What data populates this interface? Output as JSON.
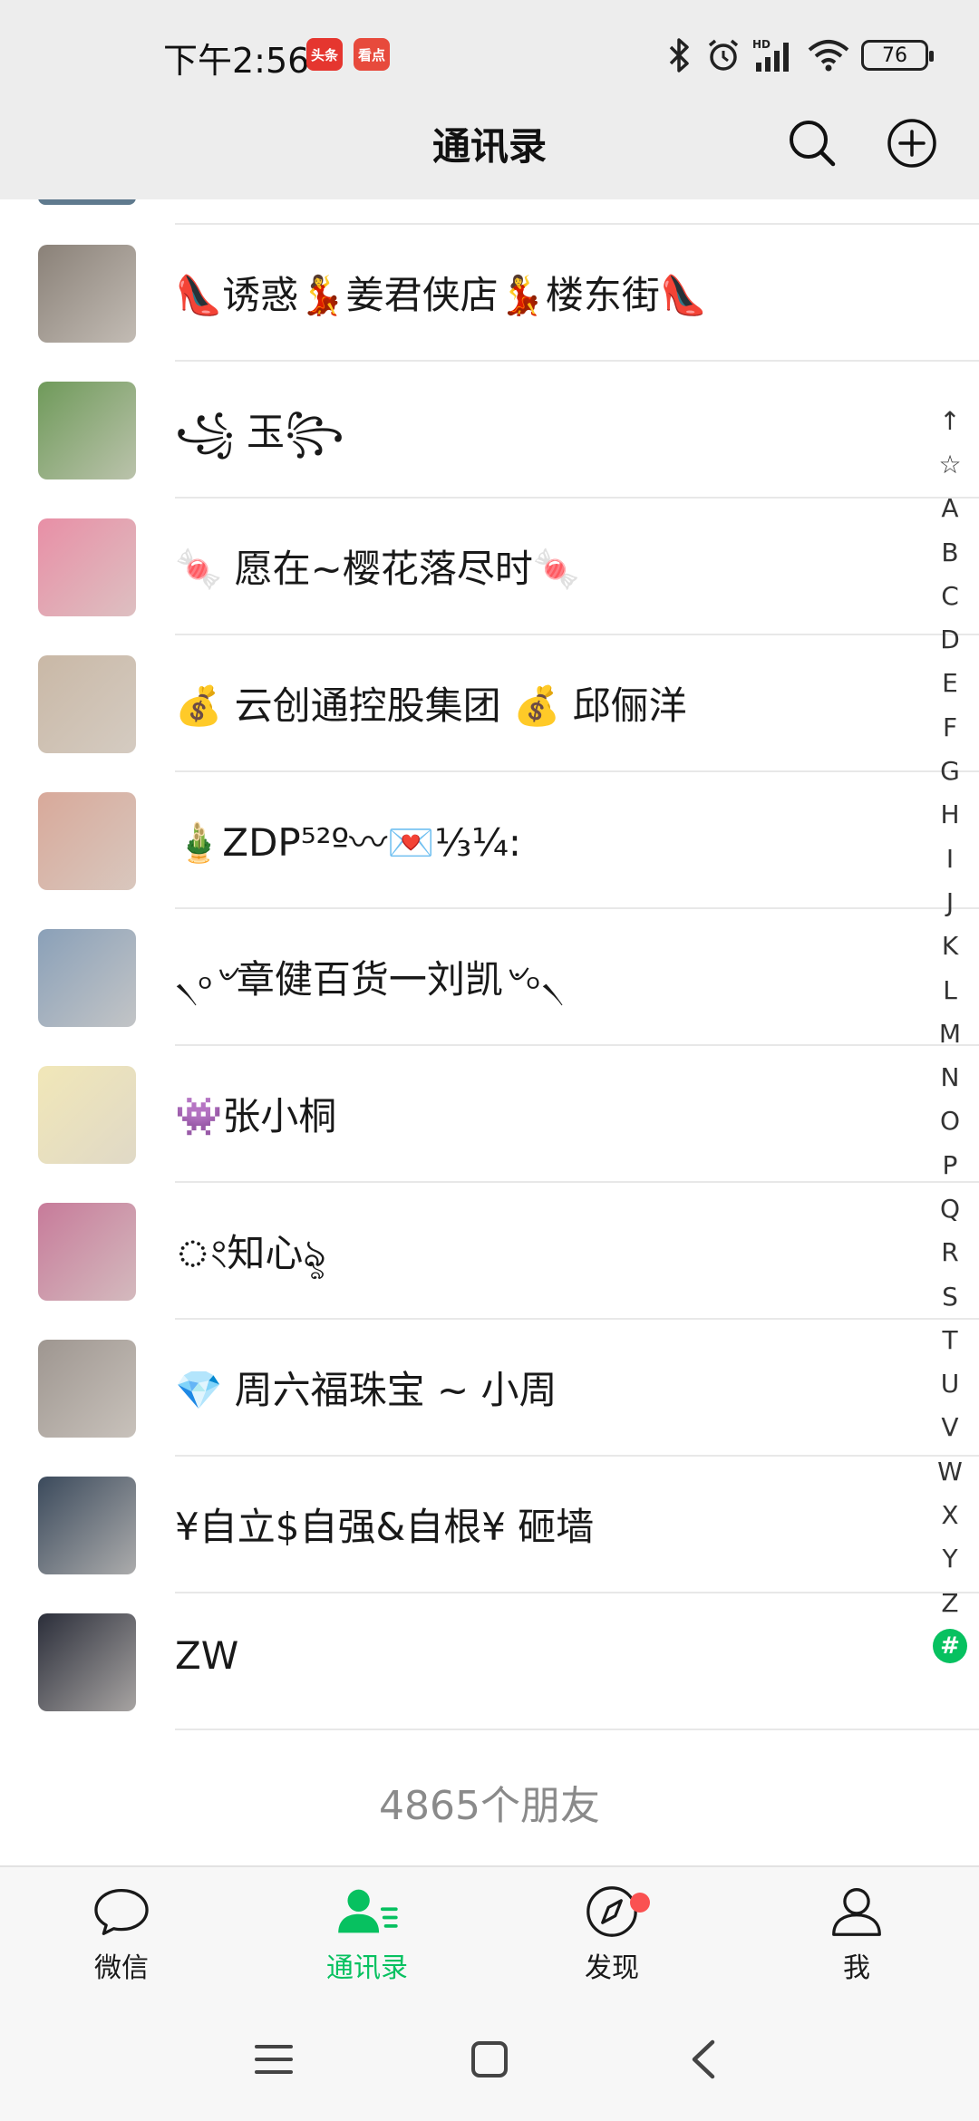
{
  "status_bar": {
    "time": "下午2:56",
    "app1": "头条",
    "app2": "看点",
    "battery": "76"
  },
  "header": {
    "title": "通讯录",
    "search_icon": "search-icon",
    "add_icon": "add-circle-icon"
  },
  "contacts": [
    {
      "name": "👠诱惑💃姜君侠店💃楼东街👠",
      "avatar_color": "#8a8178"
    },
    {
      "name": "꧁ 玉꧂",
      "avatar_color": "#6f9a5a"
    },
    {
      "name": "🍬 愿在~樱花落尽时🍬",
      "avatar_color": "#e88fa6"
    },
    {
      "name": "💰 云创通控股集团 💰 邱俪洋",
      "avatar_color": "#c9b8a6"
    },
    {
      "name": "🎍ZDP⁵²º〰💌⅓¼:",
      "avatar_color": "#d8a99a"
    },
    {
      "name": "৲৹৺章健百货一刘凯৺৹৲",
      "avatar_color": "#8aa0b8"
    },
    {
      "name": "👾张小桐",
      "avatar_color": "#f1e7b8"
    },
    {
      "name": "ং知心ৡ",
      "avatar_color": "#c77b9a"
    },
    {
      "name": "💎 周六福珠宝 ~ 小周",
      "avatar_color": "#9e9690"
    },
    {
      "name": "¥自立$自强&自根¥ 砸墙",
      "avatar_color": "#3b4a5c"
    },
    {
      "name": "ZW",
      "avatar_color": "#2b2e3a"
    }
  ],
  "friend_count": "4865个朋友",
  "index": [
    "↑",
    "☆",
    "A",
    "B",
    "C",
    "D",
    "E",
    "F",
    "G",
    "H",
    "I",
    "J",
    "K",
    "L",
    "M",
    "N",
    "O",
    "P",
    "Q",
    "R",
    "S",
    "T",
    "U",
    "V",
    "W",
    "X",
    "Y",
    "Z",
    "#"
  ],
  "tabs": [
    {
      "label": "微信",
      "icon": "chat-icon"
    },
    {
      "label": "通讯录",
      "icon": "contacts-icon"
    },
    {
      "label": "发现",
      "icon": "compass-icon"
    },
    {
      "label": "我",
      "icon": "person-icon"
    }
  ],
  "colors": {
    "accent": "#07c160",
    "badge": "#fa5151"
  }
}
